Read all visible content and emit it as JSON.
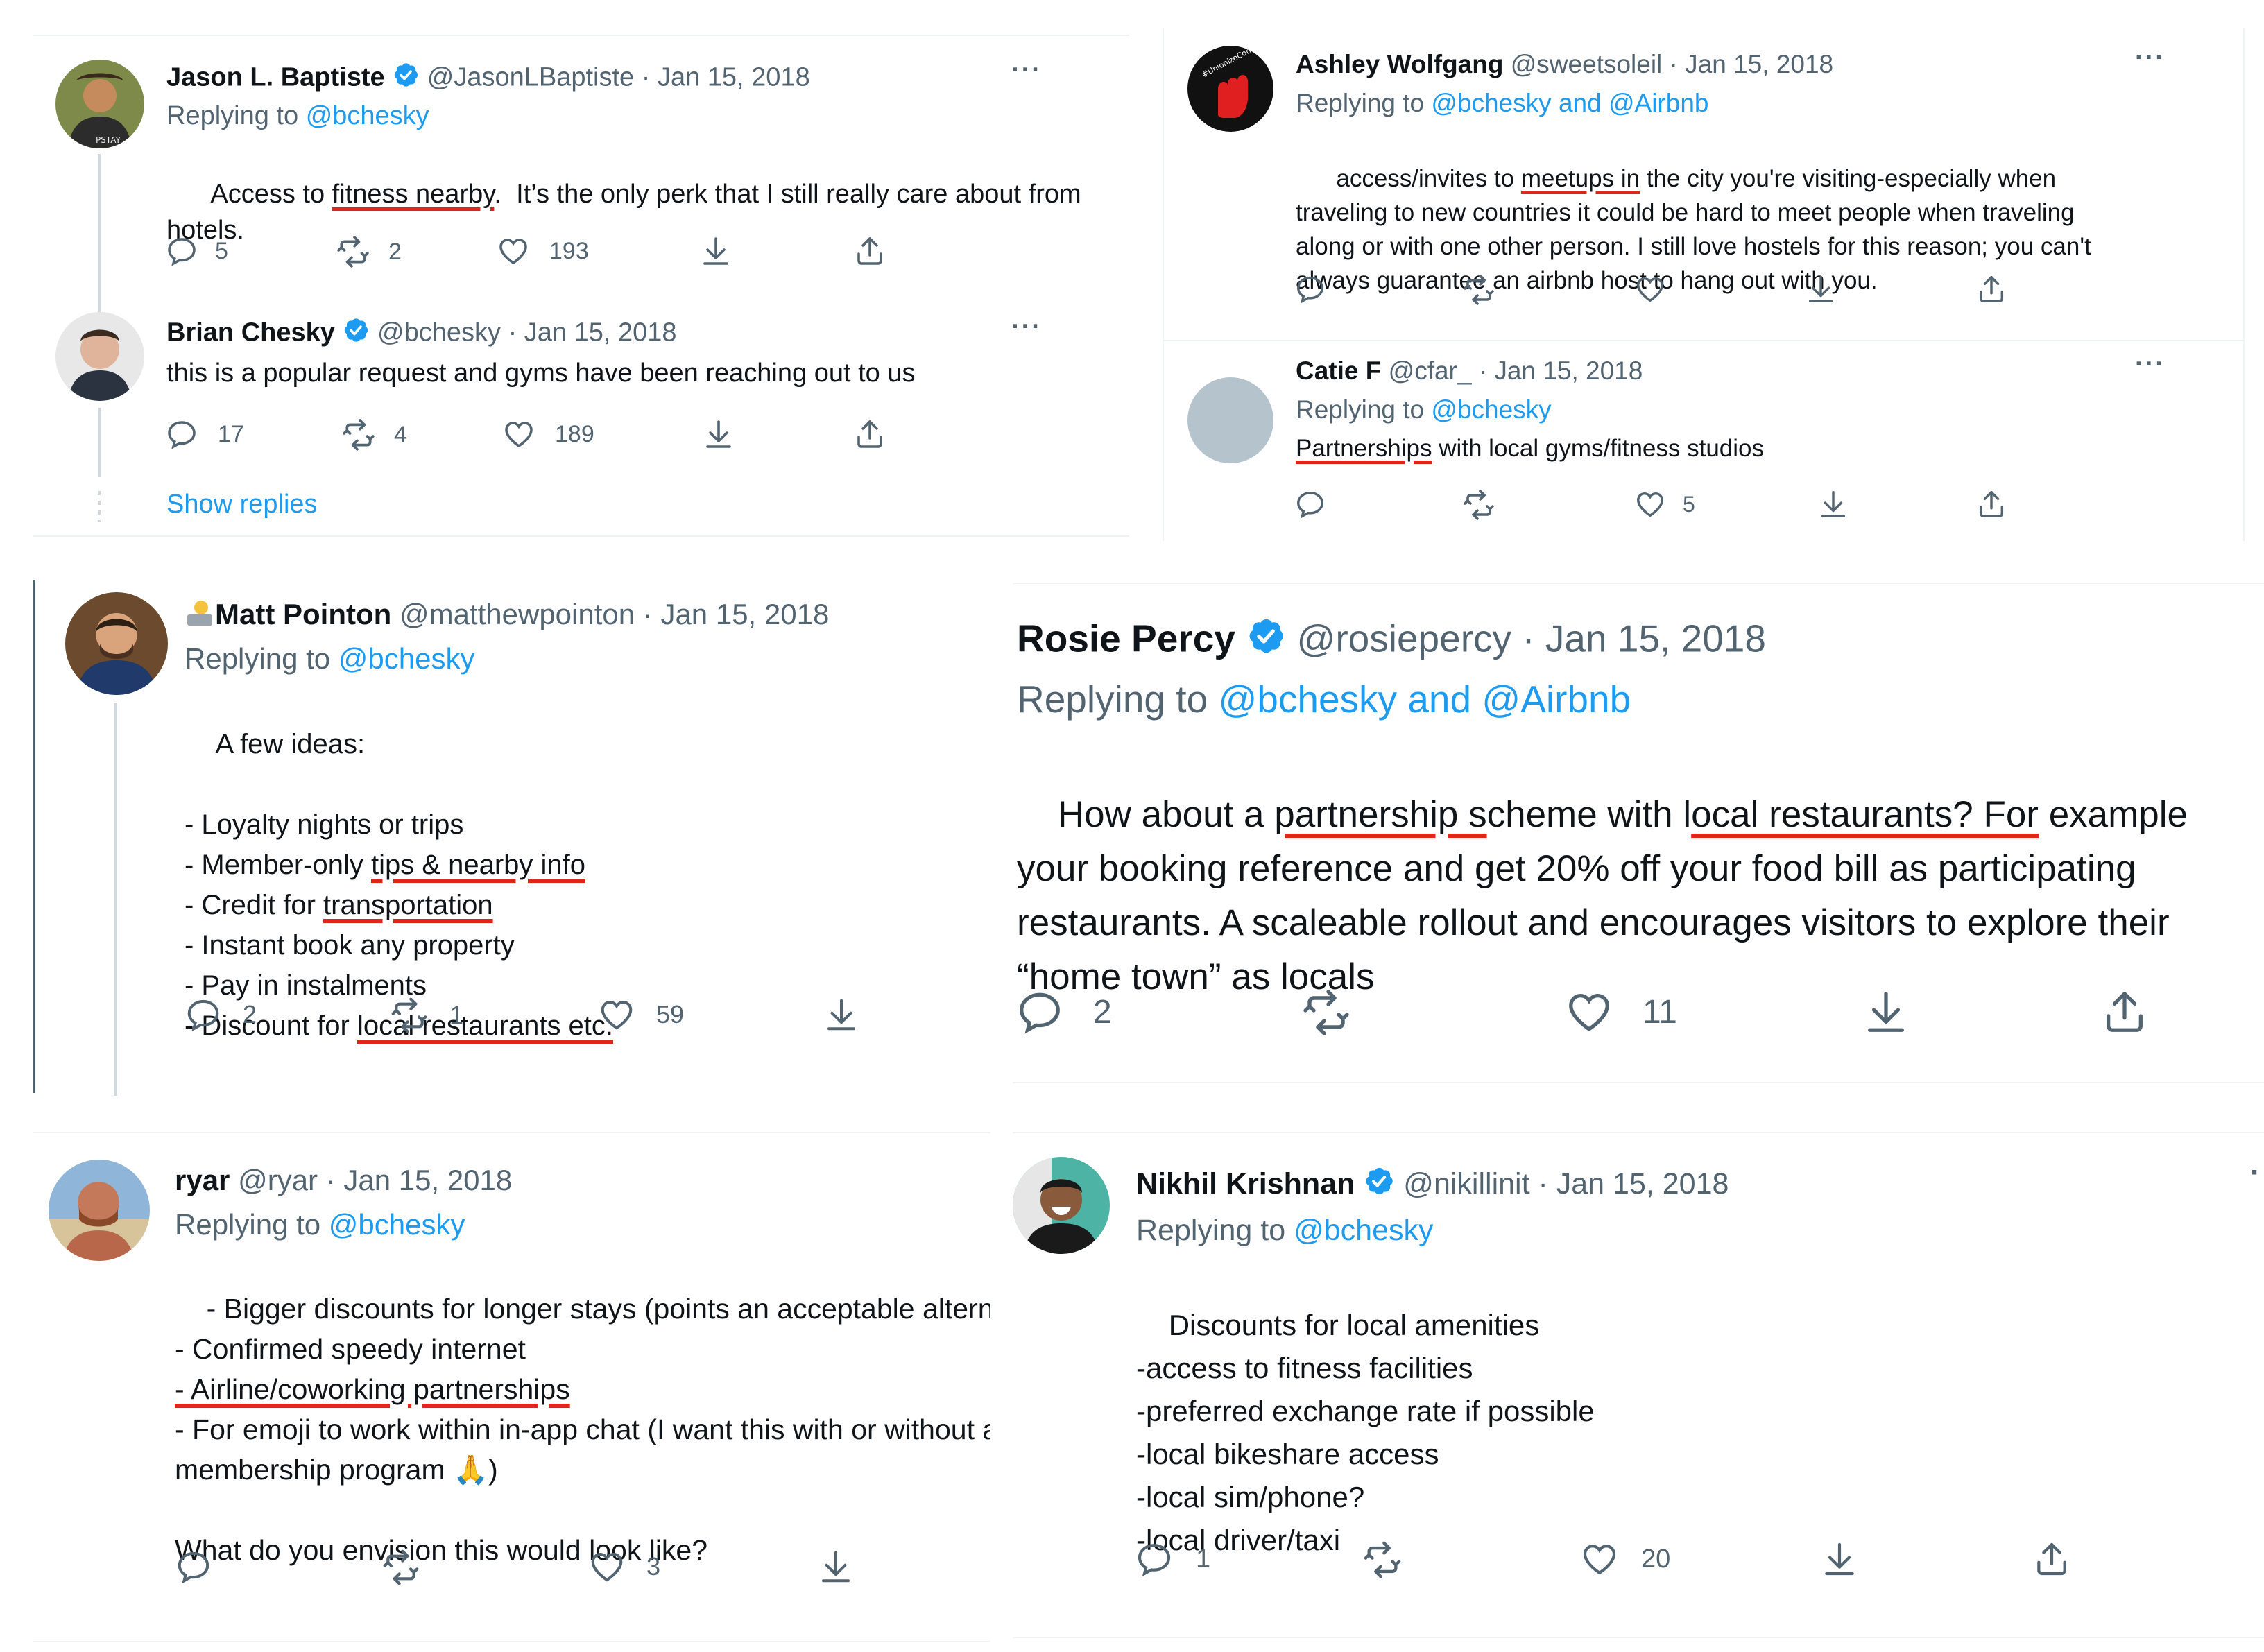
{
  "colors": {
    "link": "#1d9bf0",
    "text": "#0f1419",
    "muted": "#536471",
    "underline": "#e0261a",
    "verified": "#1d9bf0"
  },
  "panel_a": {
    "t1": {
      "name": "Jason L. Baptiste",
      "handle": "@JasonLBaptiste",
      "date": "· Jan 15, 2018",
      "reply_prefix": "Replying to",
      "reply_link": "@bchesky",
      "body_1": "Access to",
      "body_u": "fitness nearby",
      "body_2": ".  It’s the only perk that I still really care about from",
      "body_3": "hotels.",
      "avatar_text": "PSTAY",
      "replies": "5",
      "retweets": "2",
      "likes": "193",
      "more": "···"
    },
    "t2": {
      "name": "Brian Chesky",
      "handle": "@bchesky",
      "date": "· Jan 15, 2018",
      "body": "this is a popular request and gyms have been reaching out to us",
      "replies": "17",
      "retweets": "4",
      "likes": "189",
      "more": "···"
    },
    "show_replies": "Show replies"
  },
  "panel_b": {
    "t1": {
      "name": "Ashley Wolfgang",
      "handle": "@sweetsoleil",
      "date": "· Jan 15, 2018",
      "reply_prefix": "Replying to",
      "reply_link": "@bchesky and @Airbnb",
      "avatar_text": "#UnionizeCondé",
      "line1_a": "access/invites to",
      "line1_u": "meetups in",
      "line1_b": "the city you're visiting-especially when",
      "line2": "traveling to new countries it could be hard to meet people when traveling",
      "line3": "along or with one other person. I still love hostels for this reason; you can't",
      "line4": "always guarantee an airbnb host to hang out with you.",
      "more": "···"
    },
    "t2": {
      "name": "Catie F",
      "handle": "@cfar_",
      "date": "· Jan 15, 2018",
      "reply_prefix": "Replying to",
      "reply_link": "@bchesky",
      "body_u": "Partnerships",
      "body_rest": " with local gyms/fitness studios",
      "likes": "5",
      "more": "···"
    }
  },
  "panel_c": {
    "name": "Matt Pointon",
    "handle": "@matthewpointon",
    "date": "· Jan 15, 2018",
    "reply_prefix": "Replying to",
    "reply_link": "@bchesky",
    "intro": "A few ideas:",
    "l1": "- Loyalty nights or trips",
    "l2_a": "- Member-only ",
    "l2_u": "tips & nearby info",
    "l3_a": "- Credit for ",
    "l3_u": "transportation",
    "l4": "- Instant book any property",
    "l5": "- Pay in instalments",
    "l6_a": "- Discount for ",
    "l6_u": "local restaurants etc.",
    "replies": "2",
    "retweets": "1",
    "likes": "59"
  },
  "panel_d": {
    "name": "Rosie Percy",
    "handle": "@rosiepercy",
    "date": "· Jan 15, 2018",
    "reply_prefix": "Replying to",
    "reply_link": "@bchesky and @Airbnb",
    "l1_a": "How about a ",
    "l1_u1": "partnership s",
    "l1_b": "cheme with l",
    "l1_u2": "ocal restaurants? For",
    "l1_c": " example",
    "l2": "your booking reference and get 20% off your food bill as participating",
    "l3": "restaurants. A scaleable rollout and encourages visitors to explore their",
    "l4": "“home town” as locals",
    "replies": "2",
    "likes": "11"
  },
  "panel_e": {
    "name": "ryar",
    "handle": "@ryar",
    "date": "· Jan 15, 2018",
    "reply_prefix": "Replying to",
    "reply_link": "@bchesky",
    "l1": "- Bigger discounts for longer stays (points an acceptable alternative)",
    "l2": "- Confirmed speedy internet",
    "l3_u": "- Airline/coworking partnerships",
    "l4": "- For emoji to work within in-app chat (I want this with or without a",
    "l5_a": "membership program ",
    "l5_emoji": "🙏",
    "l5_b": ")",
    "l6": "What do you envision this would look like?",
    "likes": "3"
  },
  "panel_f": {
    "name": "Nikhil Krishnan",
    "handle": "@nikillinit",
    "date": "· Jan 15, 2018",
    "reply_prefix": "Replying to",
    "reply_link": "@bchesky",
    "l1": "Discounts for local amenities",
    "l2": "-access to fitness facilities",
    "l3": "-preferred exchange rate if possible",
    "l4": "-local bikeshare access",
    "l5": "-local sim/phone?",
    "l6": "-local driver/taxi",
    "replies": "1",
    "likes": "20",
    "more": "·"
  }
}
